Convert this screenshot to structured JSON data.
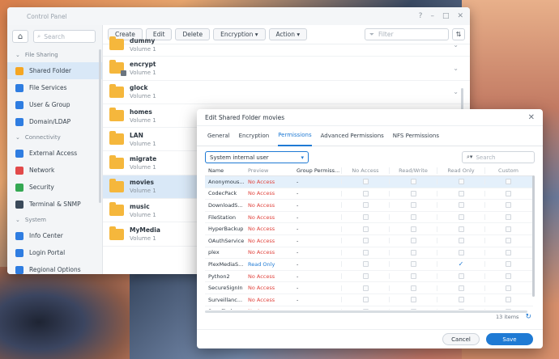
{
  "window": {
    "title": "Control Panel"
  },
  "sidebar": {
    "search_placeholder": "Search",
    "groups": [
      {
        "label": "File Sharing",
        "items": [
          {
            "label": "Shared Folder",
            "active": true,
            "icon": "shared-folder-icon",
            "color": "#f5a623"
          },
          {
            "label": "File Services",
            "active": false,
            "icon": "file-services-icon",
            "color": "#2f7de1"
          },
          {
            "label": "User & Group",
            "active": false,
            "icon": "user-group-icon",
            "color": "#2f7de1"
          },
          {
            "label": "Domain/LDAP",
            "active": false,
            "icon": "domain-icon",
            "color": "#2f7de1"
          }
        ]
      },
      {
        "label": "Connectivity",
        "items": [
          {
            "label": "External Access",
            "active": false,
            "icon": "external-access-icon",
            "color": "#2f7de1"
          },
          {
            "label": "Network",
            "active": false,
            "icon": "network-icon",
            "color": "#e24a4a"
          },
          {
            "label": "Security",
            "active": false,
            "icon": "security-icon",
            "color": "#35a853"
          },
          {
            "label": "Terminal & SNMP",
            "active": false,
            "icon": "terminal-icon",
            "color": "#3b4a5a"
          }
        ]
      },
      {
        "label": "System",
        "items": [
          {
            "label": "Info Center",
            "active": false,
            "icon": "info-icon",
            "color": "#2f7de1"
          },
          {
            "label": "Login Portal",
            "active": false,
            "icon": "login-portal-icon",
            "color": "#2f7de1"
          },
          {
            "label": "Regional Options",
            "active": false,
            "icon": "regional-icon",
            "color": "#2f7de1"
          }
        ]
      }
    ]
  },
  "toolbar": {
    "create": "Create",
    "edit": "Edit",
    "delete": "Delete",
    "encryption": "Encryption",
    "action": "Action",
    "filter_placeholder": "Filter"
  },
  "folders": [
    {
      "name": "dummy",
      "volume": "Volume 1",
      "locked": false,
      "expand": true
    },
    {
      "name": "encrypt",
      "volume": "Volume 1",
      "locked": true,
      "expand": true
    },
    {
      "name": "glock",
      "volume": "Volume 1",
      "locked": false,
      "expand": true
    },
    {
      "name": "homes",
      "volume": "Volume 1",
      "locked": false,
      "expand": false
    },
    {
      "name": "LAN",
      "volume": "Volume 1",
      "locked": false,
      "expand": false
    },
    {
      "name": "migrate",
      "volume": "Volume 1",
      "locked": false,
      "expand": false
    },
    {
      "name": "movies",
      "volume": "Volume 1",
      "locked": false,
      "expand": false,
      "active": true
    },
    {
      "name": "music",
      "volume": "Volume 1",
      "locked": false,
      "expand": false
    },
    {
      "name": "MyMedia",
      "volume": "Volume 1",
      "locked": false,
      "expand": false
    }
  ],
  "dialog": {
    "title": "Edit Shared Folder movies",
    "tabs": [
      "General",
      "Encryption",
      "Permissions",
      "Advanced Permissions",
      "NFS Permissions"
    ],
    "active_tab": "Permissions",
    "user_type": "System internal user",
    "search_placeholder": "Search",
    "columns": [
      "Name",
      "Preview",
      "Group Permiss...",
      "No Access",
      "Read/Write",
      "Read Only",
      "Custom"
    ],
    "rows": [
      {
        "name": "Anonymous...",
        "preview": "No Access",
        "group": "-",
        "read_only": false,
        "selected": true
      },
      {
        "name": "CodecPack",
        "preview": "No Access",
        "group": "-",
        "read_only": false
      },
      {
        "name": "DownloadS...",
        "preview": "No Access",
        "group": "-",
        "read_only": false
      },
      {
        "name": "FileStation",
        "preview": "No Access",
        "group": "-",
        "read_only": false
      },
      {
        "name": "HyperBackup",
        "preview": "No Access",
        "group": "-",
        "read_only": false
      },
      {
        "name": "OAuthService",
        "preview": "No Access",
        "group": "-",
        "read_only": false
      },
      {
        "name": "plex",
        "preview": "No Access",
        "group": "-",
        "read_only": false
      },
      {
        "name": "PlexMediaS...",
        "preview": "Read Only",
        "group": "-",
        "read_only": true
      },
      {
        "name": "Python2",
        "preview": "No Access",
        "group": "-",
        "read_only": false
      },
      {
        "name": "SecureSignIn",
        "preview": "No Access",
        "group": "-",
        "read_only": false
      },
      {
        "name": "Surveillanc...",
        "preview": "No Access",
        "group": "-",
        "read_only": false
      },
      {
        "name": "SynoFinder",
        "preview": "No Access",
        "group": "-",
        "read_only": false
      }
    ],
    "item_count": "13 items",
    "cancel": "Cancel",
    "save": "Save"
  }
}
